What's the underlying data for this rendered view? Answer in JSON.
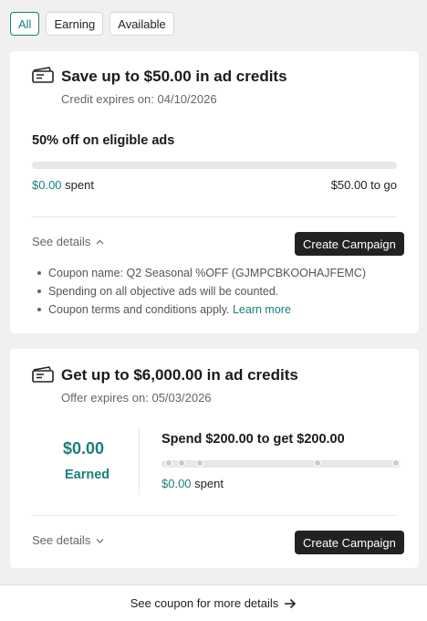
{
  "filters": [
    {
      "label": "All",
      "active": true
    },
    {
      "label": "Earning",
      "active": false
    },
    {
      "label": "Available",
      "active": false
    }
  ],
  "card1": {
    "icon": "ticket-icon",
    "title": "Save up to $50.00 in ad credits",
    "expiry": "Credit expires on: 04/10/2026",
    "offer": "50% off on eligible ads",
    "progress": 0,
    "spent_amount": "$0.00",
    "spent_label": "spent",
    "to_go": "$50.00 to go",
    "see_details": "See details",
    "see_details_icon": "chevron-up-icon",
    "cta": "Create Campaign",
    "bullets": [
      "Coupon name: Q2 Seasonal %OFF (GJMPCBKOOHAJFEMC)",
      "Spending on all objective ads will be counted."
    ],
    "terms": "Coupon terms and conditions apply.",
    "learn_more": "Learn more"
  },
  "card2": {
    "icon": "ticket-icon",
    "title": "Get up to $6,000.00 in ad credits",
    "expiry": "Offer expires on: 05/03/2026",
    "earned_amount": "$0.00",
    "earned_label": "Earned",
    "goal": "Spend $200.00 to get $200.00",
    "progress": 0,
    "spent_amount": "$0.00",
    "spent_label": "spent",
    "see_details": "See details",
    "see_details_icon": "chevron-down-icon",
    "cta": "Create Campaign"
  },
  "footer": {
    "label": "See coupon for more details",
    "icon": "arrow-right-icon"
  },
  "colors": {
    "accent": "#1a7f7a",
    "button": "#222222"
  }
}
